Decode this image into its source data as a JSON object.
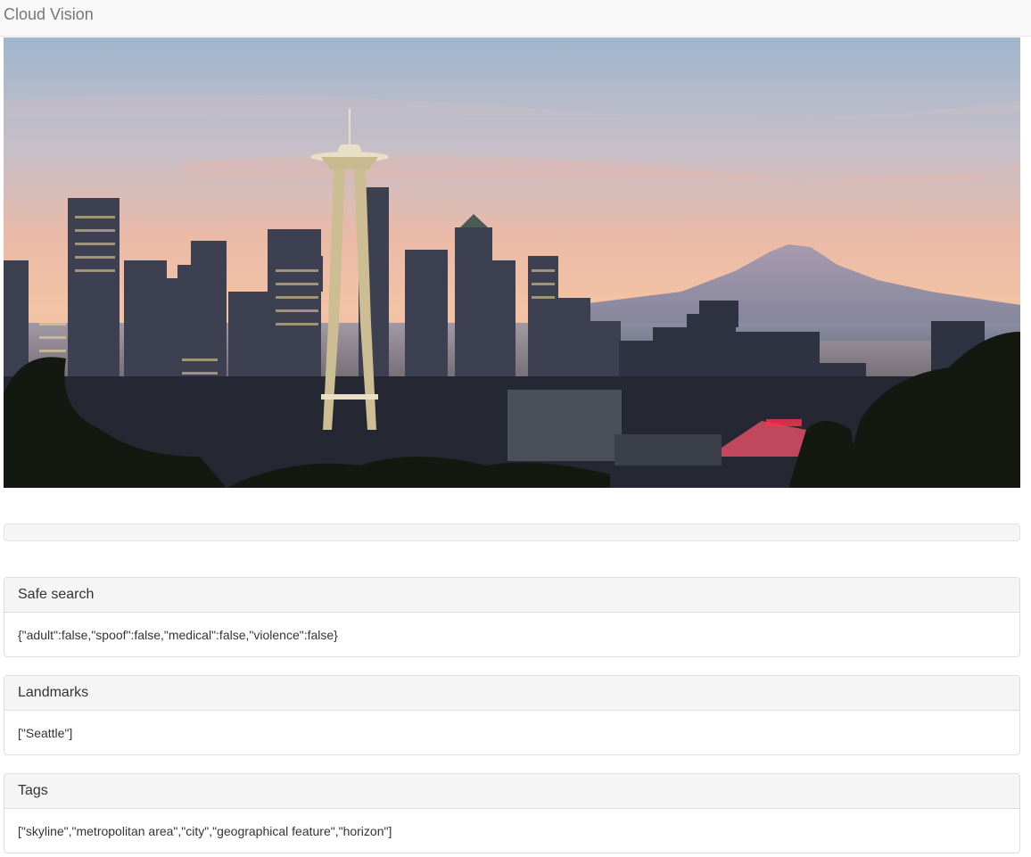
{
  "app": {
    "brand": "Cloud Vision"
  },
  "progress": {
    "value_percent": 0
  },
  "hero": {
    "alt": "Seattle skyline with Space Needle and Mount Rainier at sunset",
    "colors": {
      "sky_top": "#9fb5cc",
      "sky_mid": "#e8b9a4",
      "sky_low": "#f0c2a4",
      "mountain": "#8a8ea6",
      "city": "#3a3d4a",
      "trees": "#15190f"
    }
  },
  "panels": {
    "safe_search": {
      "title": "Safe search",
      "body": "{\"adult\":false,\"spoof\":false,\"medical\":false,\"violence\":false}"
    },
    "landmarks": {
      "title": "Landmarks",
      "body": "[\"Seattle\"]"
    },
    "tags": {
      "title": "Tags",
      "body": "[\"skyline\",\"metropolitan area\",\"city\",\"geographical feature\",\"horizon\"]"
    }
  }
}
